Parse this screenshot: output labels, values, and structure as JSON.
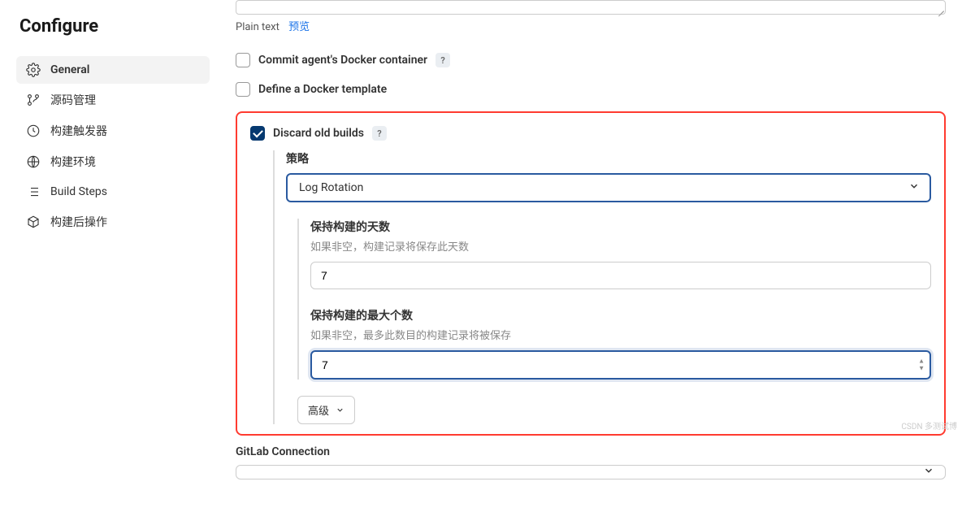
{
  "pageTitle": "Configure",
  "sidebar": {
    "items": [
      {
        "label": "General"
      },
      {
        "label": "源码管理"
      },
      {
        "label": "构建触发器"
      },
      {
        "label": "构建环境"
      },
      {
        "label": "Build Steps"
      },
      {
        "label": "构建后操作"
      }
    ]
  },
  "desc": {
    "plainText": "Plain text",
    "preview": "预览"
  },
  "checkCommit": {
    "label": "Commit agent's Docker container"
  },
  "checkTemplate": {
    "label": "Define a Docker template"
  },
  "discard": {
    "label": "Discard old builds",
    "strategyLabel": "策略",
    "strategyValue": "Log Rotation",
    "daysLabel": "保持构建的天数",
    "daysHint": "如果非空，构建记录将保存此天数",
    "daysValue": "7",
    "maxLabel": "保持构建的最大个数",
    "maxHint": "如果非空，最多此数目的构建记录将被保存",
    "maxValue": "7",
    "advanced": "高级"
  },
  "gitlab": {
    "label": "GitLab Connection",
    "value": ""
  },
  "helpGlyph": "?",
  "watermark": "CSDN 多测试博"
}
